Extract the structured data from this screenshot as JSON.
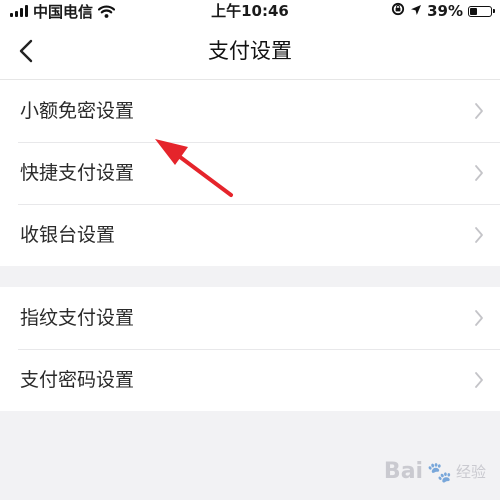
{
  "status_bar": {
    "carrier": "中国电信",
    "time": "上午10:46",
    "battery": "39%",
    "battery_level": 0.39
  },
  "nav": {
    "title": "支付设置"
  },
  "groups": [
    {
      "items": [
        {
          "label": "小额免密设置"
        },
        {
          "label": "快捷支付设置"
        },
        {
          "label": "收银台设置"
        }
      ]
    },
    {
      "items": [
        {
          "label": "指纹支付设置"
        },
        {
          "label": "支付密码设置"
        }
      ]
    }
  ],
  "annotation": {
    "color": "#e5242b"
  },
  "watermark": {
    "brand": "Bai",
    "suffix": "经验"
  },
  "colors": {
    "background": "#f2f2f4",
    "chevron": "#c4c4c8"
  }
}
